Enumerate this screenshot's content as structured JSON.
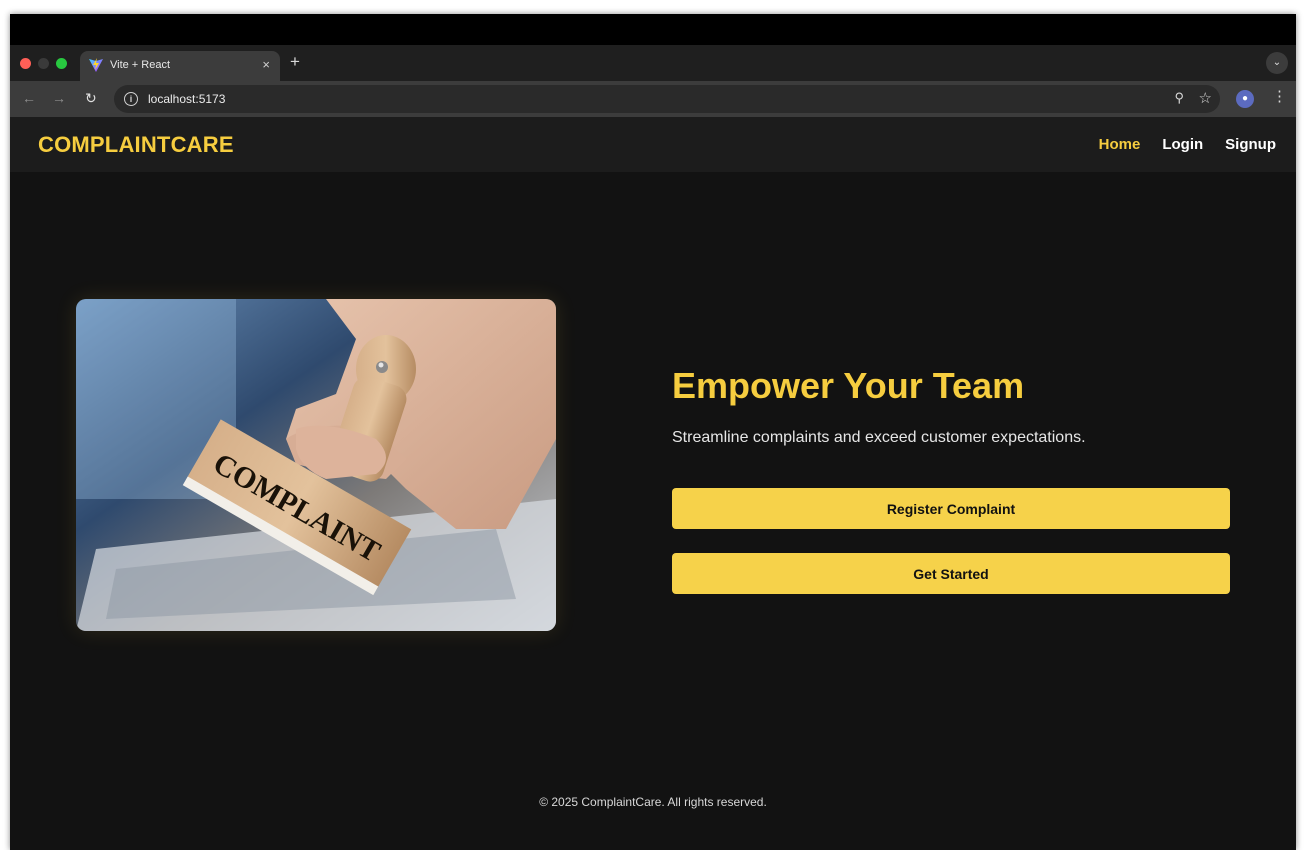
{
  "browser": {
    "tab_title": "Vite + React",
    "tab_close": "×",
    "new_tab": "+",
    "url": "localhost:5173",
    "icons": [
      "back-arrow-icon",
      "forward-arrow-icon",
      "reload-icon",
      "info-icon",
      "zoom-icon",
      "star-icon",
      "profile-avatar",
      "menu-icon",
      "tab-search-icon"
    ]
  },
  "site": {
    "logo": "COMPLAINTCARE",
    "nav": {
      "home": "Home",
      "login": "Login",
      "signup": "Signup"
    },
    "accent_color": "#f6cd3f"
  },
  "hero": {
    "image_stamp_text": "COMPLAINT",
    "title": "Empower Your Team",
    "subtitle": "Streamline complaints and exceed customer expectations.",
    "register_button": "Register Complaint",
    "start_button": "Get Started"
  },
  "footer": {
    "text": "© 2025 ComplaintCare. All rights reserved."
  }
}
